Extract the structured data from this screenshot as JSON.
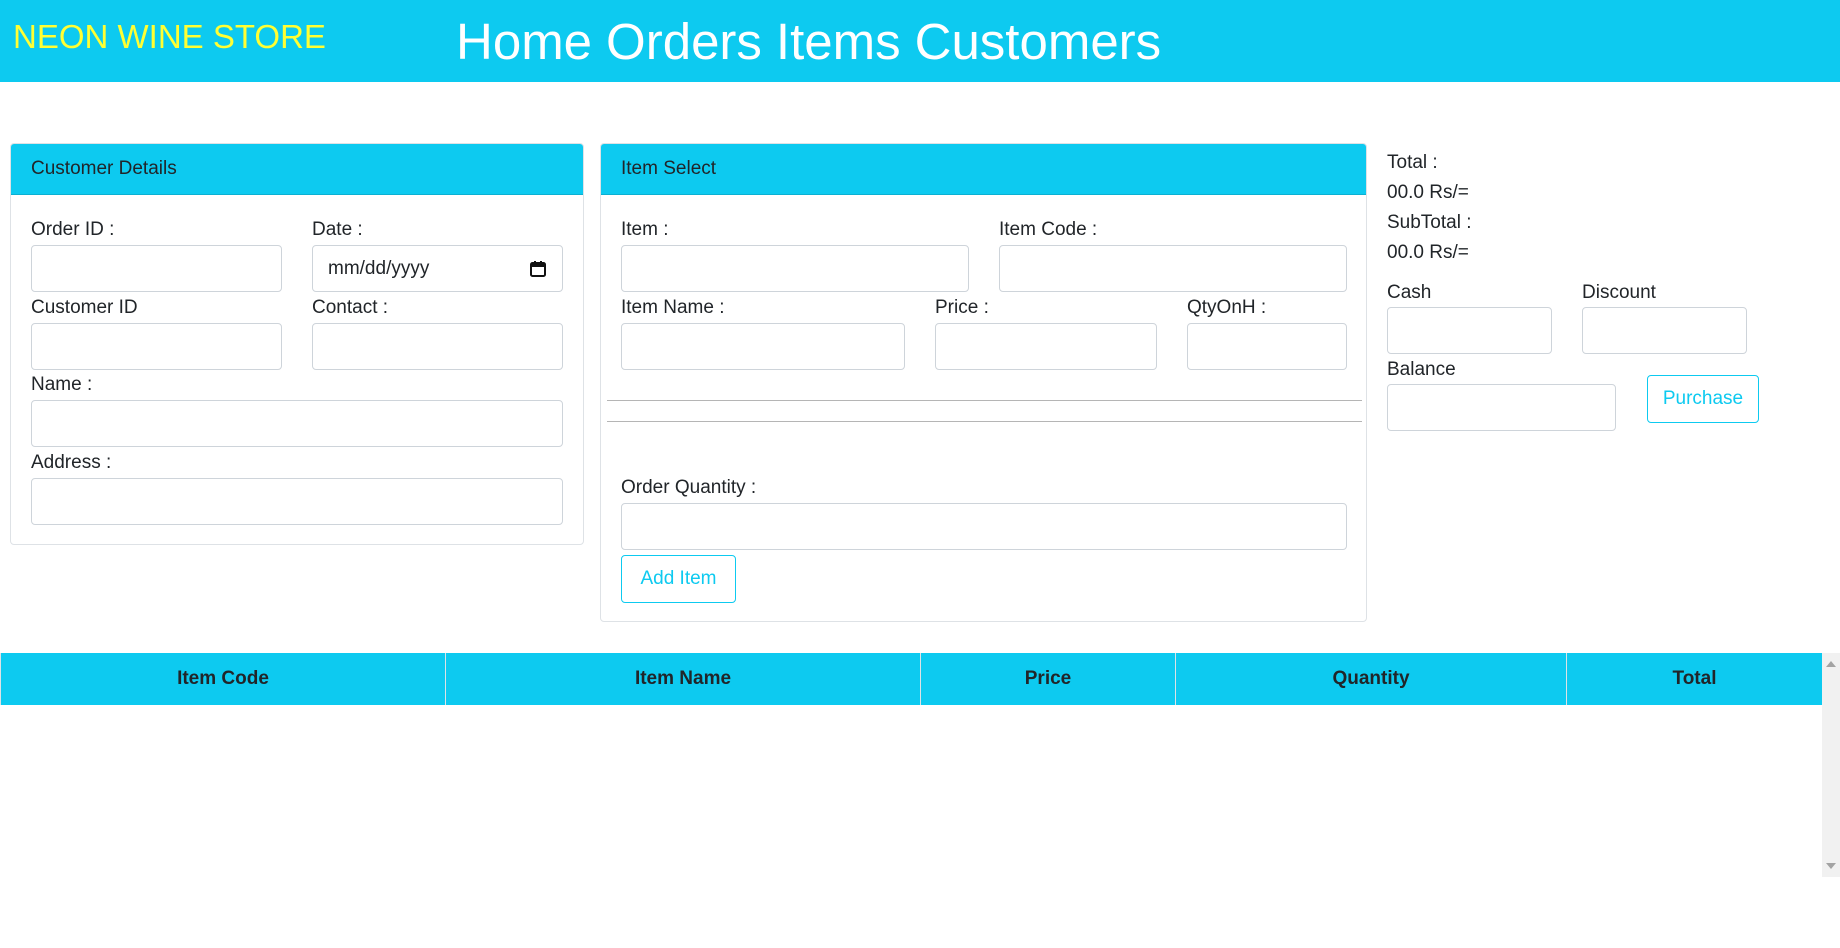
{
  "nav": {
    "brand": "NEON WINE STORE",
    "links": [
      "Home",
      "Orders",
      "Items",
      "Customers"
    ]
  },
  "customer_card": {
    "title": "Customer Details",
    "order_id_label": "Order ID :",
    "date_label": "Date :",
    "date_placeholder": "mm/dd/yyyy",
    "customer_id_label": "Customer ID",
    "contact_label": "Contact :",
    "name_label": "Name :",
    "address_label": "Address :"
  },
  "item_card": {
    "title": "Item Select",
    "item_label": "Item :",
    "item_code_label": "Item Code :",
    "item_name_label": "Item Name :",
    "price_label": "Price :",
    "qty_on_hand_label": "QtyOnH :",
    "order_qty_label": "Order Quantity :",
    "add_item_button": "Add Item"
  },
  "summary": {
    "total_label": "Total :",
    "total_value": "00.0 Rs/=",
    "subtotal_label": "SubTotal :",
    "subtotal_value": "00.0 Rs/=",
    "cash_label": "Cash",
    "discount_label": "Discount",
    "balance_label": "Balance",
    "purchase_button": "Purchase"
  },
  "table": {
    "headers": [
      "Item Code",
      "Item Name",
      "Price",
      "Quantity",
      "Total"
    ],
    "rows": []
  },
  "colors": {
    "accent": "#0dcaf0",
    "brand": "#ffff33"
  }
}
